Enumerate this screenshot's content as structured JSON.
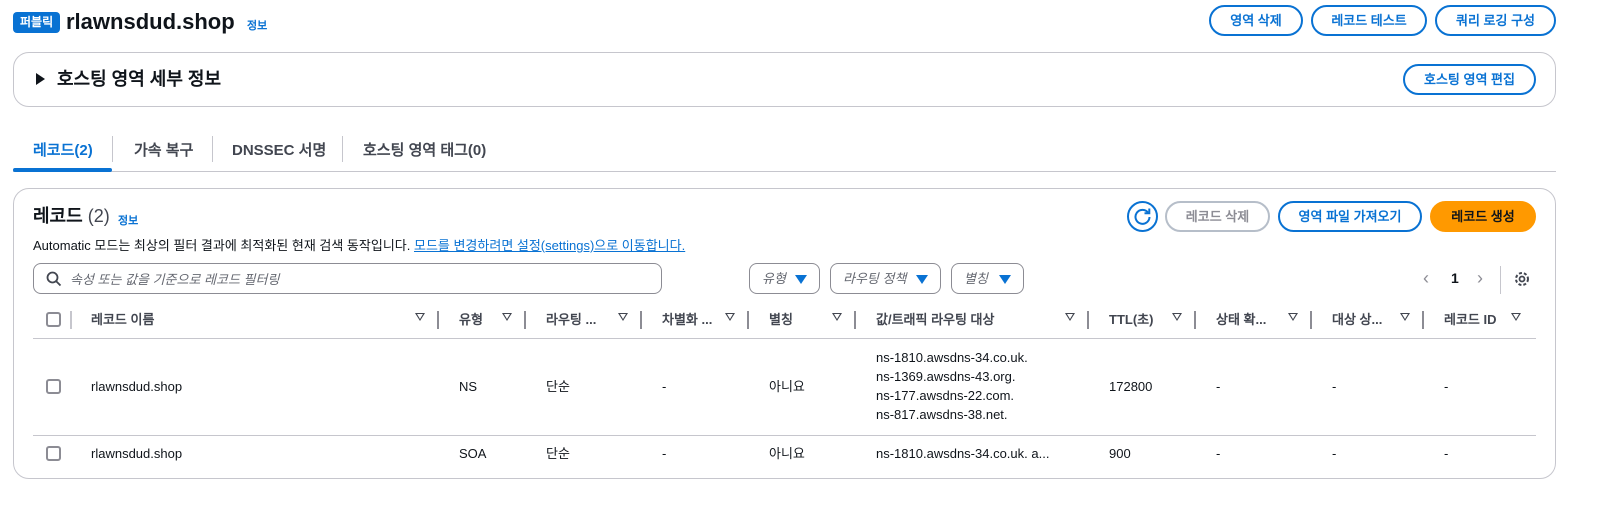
{
  "header": {
    "badge": "퍼블릭",
    "title": "rlawnsdud.shop",
    "info": "정보",
    "buttons": {
      "delete_zone": "영역 삭제",
      "test_record": "레코드 테스트",
      "query_logging": "쿼리 로깅 구성"
    }
  },
  "details": {
    "toggle_icon": "caret-right-icon",
    "title": "호스팅 영역 세부 정보",
    "edit_button": "호스팅 영역 편집"
  },
  "tabs": [
    {
      "label": "레코드(2)",
      "active": true
    },
    {
      "label": "가속 복구",
      "active": false
    },
    {
      "label": "DNSSEC 서명",
      "active": false
    },
    {
      "label": "호스팅 영역 태그(0)",
      "active": false
    }
  ],
  "records": {
    "title": "레코드",
    "count": "(2)",
    "info": "정보",
    "description": "Automatic 모드는 최상의 필터 결과에 최적화된 현재 검색 동작입니다.",
    "description_link": "모드를 변경하려면 설정(settings)으로 이동합니다.",
    "buttons": {
      "delete": "레코드 삭제",
      "import": "영역 파일 가져오기",
      "create": "레코드 생성"
    },
    "search_placeholder": "속성 또는 값을 기준으로 레코드 필터링",
    "filters": {
      "type": "유형",
      "routing": "라우팅 정책",
      "alias": "별칭"
    },
    "page": "1",
    "columns": [
      "레코드 이름",
      "유형",
      "라우팅 ...",
      "차별화 ...",
      "별칭",
      "값/트래픽 라우팅 대상",
      "TTL(초)",
      "상태 확...",
      "대상 상...",
      "레코드 ID"
    ],
    "rows": [
      {
        "name": "rlawnsdud.shop",
        "type": "NS",
        "routing": "단순",
        "diff": "-",
        "alias": "아니요",
        "values": [
          "ns-1810.awsdns-34.co.uk.",
          "ns-1369.awsdns-43.org.",
          "ns-177.awsdns-22.com.",
          "ns-817.awsdns-38.net."
        ],
        "ttl": "172800",
        "health": "-",
        "target_health": "-",
        "record_id": "-"
      },
      {
        "name": "rlawnsdud.shop",
        "type": "SOA",
        "routing": "단순",
        "diff": "-",
        "alias": "아니요",
        "values": [
          "ns-1810.awsdns-34.co.uk. a..."
        ],
        "ttl": "900",
        "health": "-",
        "target_health": "-",
        "record_id": "-"
      }
    ]
  },
  "colors": {
    "accent": "#0972d3",
    "primary": "#ff9900",
    "border": "#c6c6cd"
  }
}
